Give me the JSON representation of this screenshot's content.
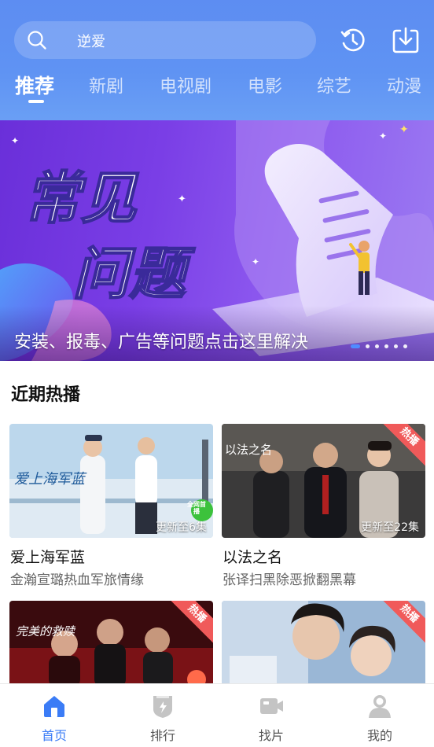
{
  "search": {
    "text": "逆爱"
  },
  "header_icons": [
    "history-icon",
    "download-icon"
  ],
  "tabs": [
    {
      "label": "推荐",
      "active": true
    },
    {
      "label": "新剧",
      "active": false
    },
    {
      "label": "电视剧",
      "active": false
    },
    {
      "label": "电影",
      "active": false
    },
    {
      "label": "综艺",
      "active": false
    },
    {
      "label": "动漫",
      "active": false
    }
  ],
  "banner": {
    "headline_line1": "常见",
    "headline_line2": "问题",
    "caption": "安装、报毒、广告等问题点击这里解决",
    "slide_count": 6,
    "active_slide": 0
  },
  "section": {
    "title": "近期热播"
  },
  "cards": [
    {
      "title": "爱上海军蓝",
      "subtitle": "金瀚宣璐热血军旅情缘",
      "update": "更新至6集",
      "hot": "",
      "poster_text": "爱上海军蓝",
      "badge": "全网首播"
    },
    {
      "title": "以法之名",
      "subtitle": "张译扫黑除恶掀翻黑幕",
      "update": "更新至22集",
      "hot": "热播",
      "poster_text": "以法之名",
      "badge": ""
    },
    {
      "title": "",
      "subtitle": "",
      "update": "",
      "hot": "热播",
      "poster_text": "完美的救赎",
      "badge": ""
    },
    {
      "title": "",
      "subtitle": "",
      "update": "",
      "hot": "热播",
      "poster_text": "",
      "badge": ""
    }
  ],
  "bottom_nav": [
    {
      "label": "首页",
      "icon": "home-icon",
      "active": true
    },
    {
      "label": "排行",
      "icon": "ranking-icon",
      "active": false
    },
    {
      "label": "找片",
      "icon": "video-camera-icon",
      "active": false
    },
    {
      "label": "我的",
      "icon": "user-icon",
      "active": false
    }
  ],
  "colors": {
    "header": "#5f93f3",
    "accent": "#3b7cf6",
    "hot": "#f05a5a",
    "banner": "#7a3ee6"
  }
}
